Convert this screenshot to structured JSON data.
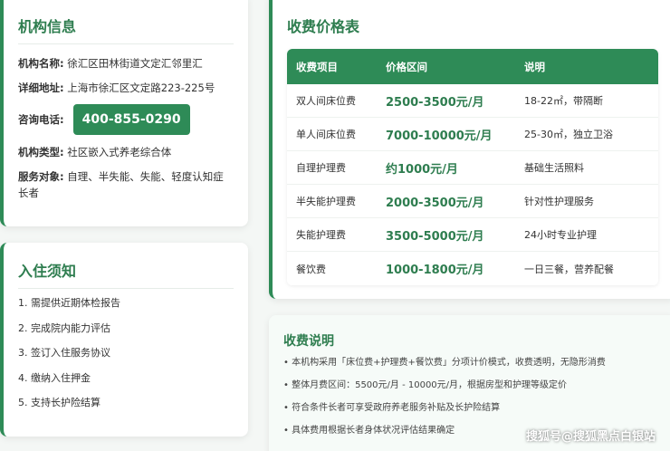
{
  "info": {
    "title": "机构信息",
    "name_label": "机构名称:",
    "name_value": "徐汇区田林街道文定汇邻里汇",
    "address_label": "详细地址:",
    "address_value": "上海市徐汇区文定路223-225号",
    "phone_label": "咨询电话:",
    "phone_value": "400-855-0290",
    "type_label": "机构类型:",
    "type_value": "社区嵌入式养老综合体",
    "target_label": "服务对象:",
    "target_value": "自理、半失能、失能、轻度认知症长者"
  },
  "notice": {
    "title": "入住须知",
    "items": [
      "1. 需提供近期体检报告",
      "2. 完成院内能力评估",
      "3. 签订入住服务协议",
      "4. 缴纳入住押金",
      "5. 支持长护险结算"
    ]
  },
  "price": {
    "title": "收费价格表",
    "headers": [
      "收费项目",
      "价格区间",
      "说明"
    ],
    "rows": [
      [
        "双人间床位费",
        "2500-3500元/月",
        "18-22㎡，带隔断"
      ],
      [
        "单人间床位费",
        "7000-10000元/月",
        "25-30㎡，独立卫浴"
      ],
      [
        "自理护理费",
        "约1000元/月",
        "基础生活照料"
      ],
      [
        "半失能护理费",
        "2000-3500元/月",
        "针对性护理服务"
      ],
      [
        "失能护理费",
        "3500-5000元/月",
        "24小时专业护理"
      ],
      [
        "餐饮费",
        "1000-1800元/月",
        "一日三餐，营养配餐"
      ]
    ]
  },
  "desc": {
    "title": "收费说明",
    "items": [
      "• 本机构采用「床位费+护理费+餐饮费」分项计价模式，收费透明，无隐形消费",
      "• 整体月费区间：5500元/月 - 10000元/月，根据房型和护理等级定价",
      "• 符合条件长者可享受政府养老服务补贴及长护险结算",
      "• 具体费用根据长者身体状况评估结果确定"
    ]
  },
  "watermark": "搜狐号@搜狐黑点白银站"
}
